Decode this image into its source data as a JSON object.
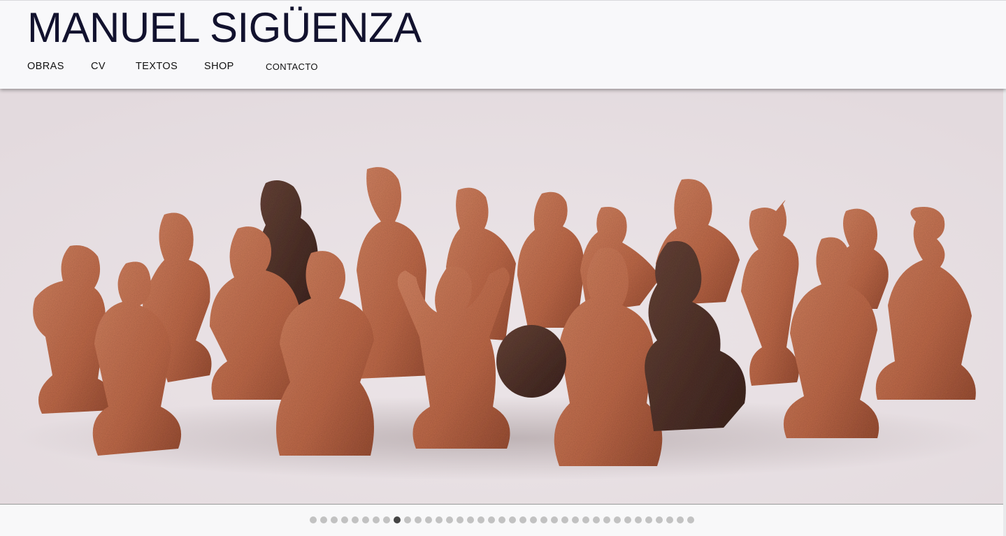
{
  "site": {
    "title": "MANUEL SIGÜENZA"
  },
  "nav": {
    "items": [
      {
        "label": "OBRAS"
      },
      {
        "label": "CV"
      },
      {
        "label": "TEXTOS"
      },
      {
        "label": "SHOP"
      },
      {
        "label": "CONTACTO"
      }
    ]
  },
  "slider": {
    "total_slides": 37,
    "active_index": 8
  },
  "colors": {
    "title": "#12122e",
    "slide_background": "#e7dfe3",
    "terracotta": "#c1704f",
    "dark_clay": "#5a3a31",
    "dot_inactive": "#c2c2c2",
    "dot_active": "#444444"
  }
}
